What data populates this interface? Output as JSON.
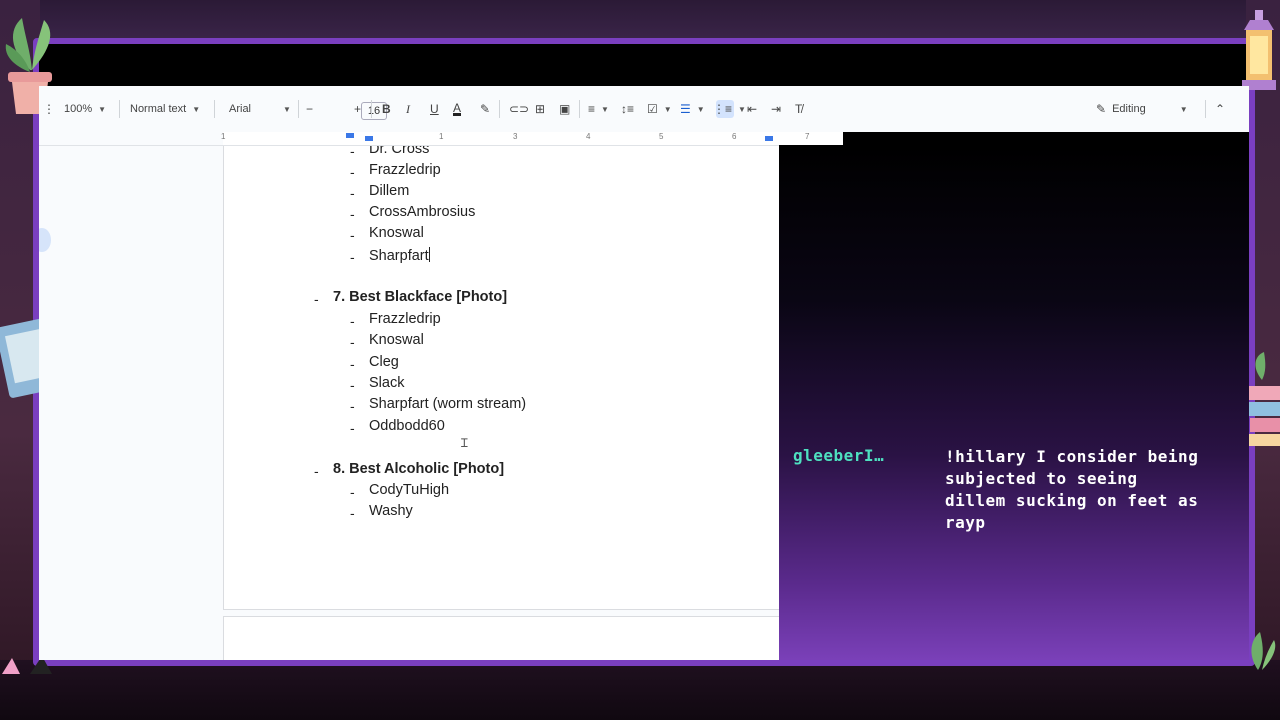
{
  "toolbar": {
    "zoom": "100%",
    "style": "Normal text",
    "font": "Arial",
    "font_size": "16",
    "mode": "Editing",
    "ruler_numbers": [
      "1",
      "1",
      "2",
      "3",
      "4",
      "5",
      "6",
      "7"
    ]
  },
  "doc": {
    "prev_list": [
      "Dr. Cross",
      "Frazzledrip",
      "Dillem",
      "CrossAmbrosius",
      "Knoswal",
      "Sharpfart"
    ],
    "section7": {
      "heading": "7. Best Blackface [Photo]",
      "items": [
        "Frazzledrip",
        "Knoswal",
        "Cleg",
        "Slack",
        "Sharpfart (worm stream)",
        "Oddbodd60"
      ]
    },
    "section8": {
      "heading": "8. Best Alcoholic [Photo]",
      "items": [
        "CodyTuHigh",
        "Washy"
      ]
    },
    "dash": "-"
  },
  "chat": {
    "username": "gleeberI…",
    "message": "!hillary I consider being subjected to seeing dillem sucking on feet as rayp"
  },
  "colors": {
    "frame": "#7a3fc0",
    "chat_username": "#4ee0c0",
    "toolbar_bg": "#f9fbfd"
  }
}
